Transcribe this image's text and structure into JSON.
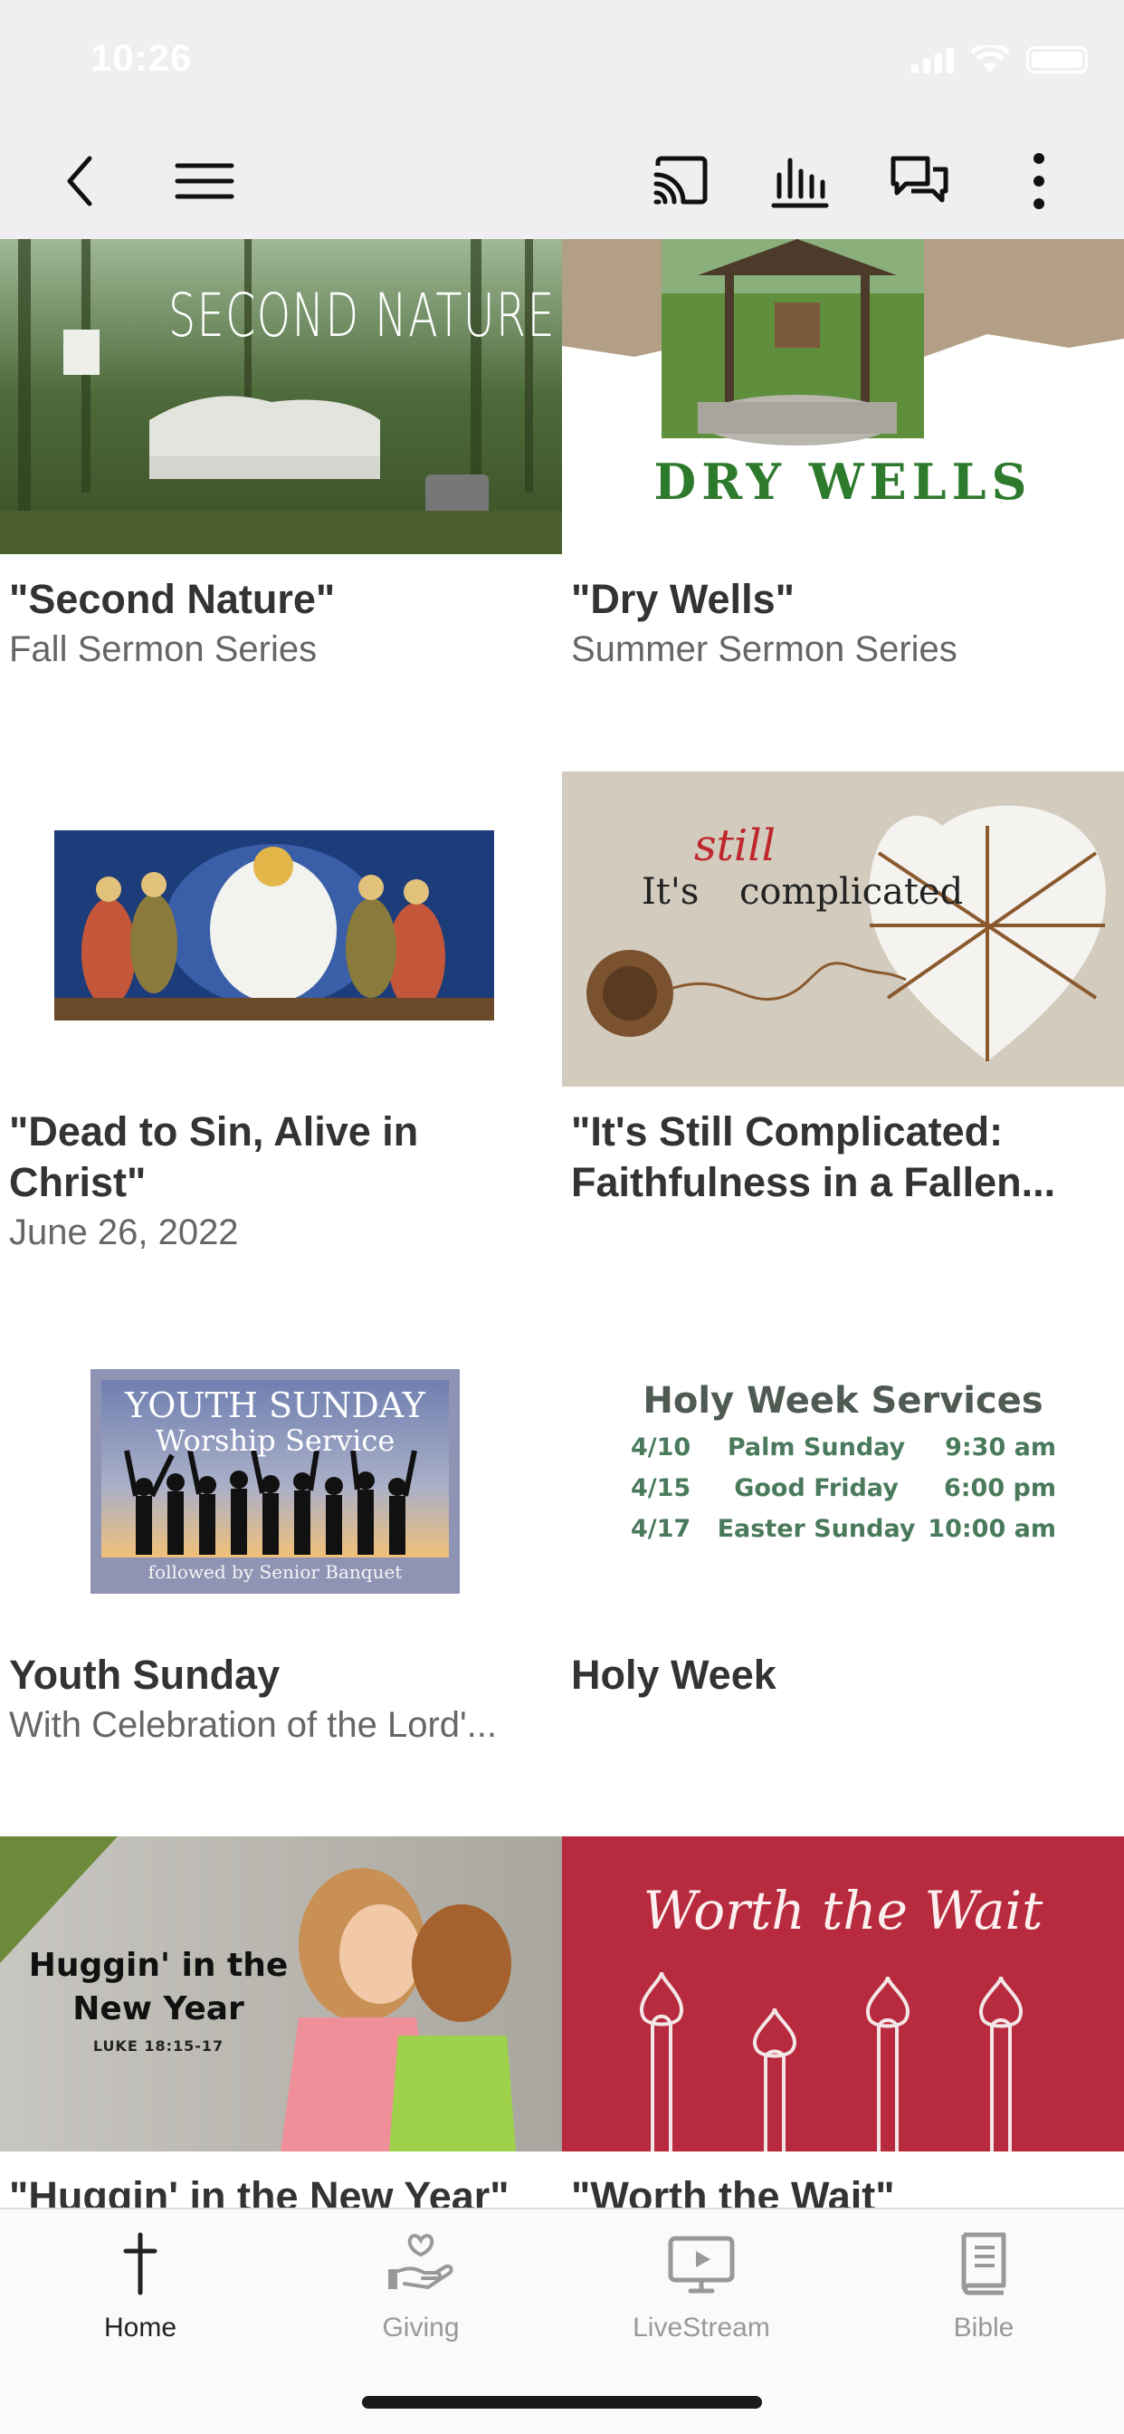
{
  "status_bar": {
    "time": "10:26"
  },
  "header": {
    "buttons": [
      "back",
      "menu",
      "cast",
      "audio",
      "chat",
      "more"
    ]
  },
  "cards": [
    {
      "title": "\"Second Nature\"",
      "subtitle": "Fall Sermon Series",
      "image_text": "SECOND NATURE"
    },
    {
      "title": "\"Dry Wells\"",
      "subtitle": "Summer Sermon Series",
      "image_text": "DRY WELLS"
    },
    {
      "title": "\"Dead to Sin, Alive in Christ\"",
      "subtitle": "June 26, 2022",
      "image_text": ""
    },
    {
      "title": "\"It's Still Complicated: Faithfulness in a Fallen...",
      "subtitle": "",
      "image_text_1": "It's",
      "image_text_2": "still",
      "image_text_3": "complicated"
    },
    {
      "title": "Youth Sunday",
      "subtitle": "With Celebration of the Lord'...",
      "image_text_1": "YOUTH SUNDAY",
      "image_text_2": "Worship Service",
      "image_text_3": "followed by Senior Banquet"
    },
    {
      "title": "Holy Week",
      "subtitle": "",
      "image_heading": "Holy Week Services",
      "schedule": [
        {
          "date": "4/10",
          "name": "Palm Sunday",
          "time": "9:30 am"
        },
        {
          "date": "4/15",
          "name": "Good Friday",
          "time": "6:00 pm"
        },
        {
          "date": "4/17",
          "name": "Easter Sunday",
          "time": "10:00 am"
        }
      ]
    },
    {
      "title": "\"Huggin' in the New Year\"",
      "subtitle": "",
      "image_text_1": "Huggin' in the",
      "image_text_2": "New Year",
      "image_text_3": "LUKE 18:15-17"
    },
    {
      "title": "\"Worth the Wait\"",
      "subtitle": "",
      "image_text": "Worth the Wait"
    }
  ],
  "tabs": [
    {
      "label": "Home",
      "icon": "cross-icon",
      "active": true
    },
    {
      "label": "Giving",
      "icon": "giving-hand-icon",
      "active": false
    },
    {
      "label": "LiveStream",
      "icon": "play-screen-icon",
      "active": false
    },
    {
      "label": "Bible",
      "icon": "book-icon",
      "active": false
    }
  ],
  "colors": {
    "header_bg": "#efeff1",
    "worth_wait_red": "#b82a3d",
    "dry_wells_green": "#2d7a2d",
    "holy_week_green": "#4a7a5c"
  }
}
